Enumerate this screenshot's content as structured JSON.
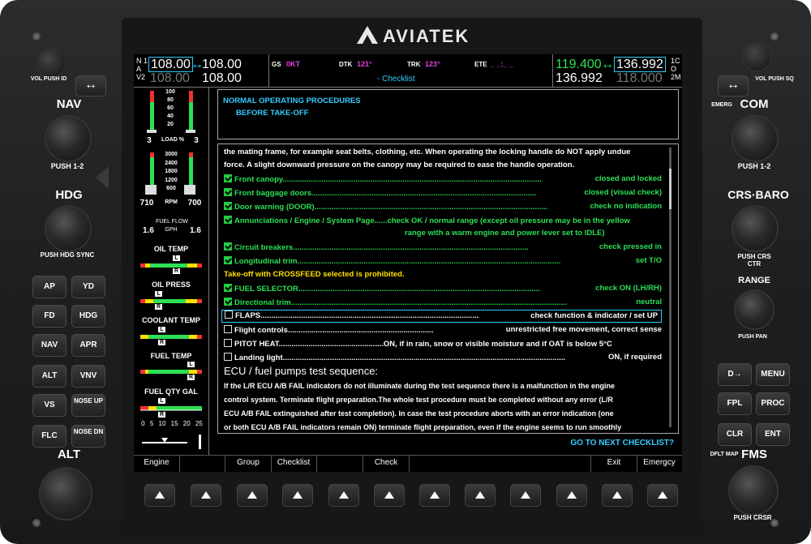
{
  "brand": "AVIATEK",
  "top": {
    "nav_letters": [
      "N",
      "A",
      "V",
      "1",
      "2"
    ],
    "nav_active": "108.00",
    "nav_active_arrow": "↔",
    "nav_standby": "108.00",
    "nav2_active": "108.00",
    "nav2_standby": "108.00",
    "gs_lbl": "GS",
    "gs_val": "0KT",
    "dtk_lbl": "DTK",
    "dtk_val": "121°",
    "trk_lbl": "TRK",
    "trk_val": "123°",
    "ete_lbl": "ETE",
    "ete_val": "_ _:_ _",
    "page_title": "- Checklist",
    "com_active": "119.400",
    "com_arrow": "↔",
    "com_standby": "136.992",
    "com2_active": "136.992",
    "com2_standby": "118.000",
    "com_letters": [
      "1",
      "C",
      "O",
      "2",
      "M"
    ]
  },
  "engine": {
    "load_ticks": [
      "100",
      "80",
      "60",
      "40",
      "20"
    ],
    "load_lbl": "LOAD %",
    "load_l": "3",
    "load_r": "3",
    "rpm_ticks": [
      "3000",
      "2400",
      "1800",
      "1200",
      "600"
    ],
    "rpm_lbl": "RPM",
    "rpm_l": "710",
    "rpm_r": "700",
    "ff_lbl": "FUEL FLOW",
    "ff_unit": "GPH",
    "ff_l": "1.6",
    "ff_r": "1.6",
    "oil_temp": "OIL TEMP",
    "oil_press": "OIL PRESS",
    "coolant": "COOLANT TEMP",
    "fuel_temp": "FUEL TEMP",
    "fuel_qty": "FUEL QTY GAL",
    "lr_l": "L",
    "lr_r": "R",
    "qty_scale": [
      "0",
      "5",
      "10",
      "15",
      "20",
      "25"
    ]
  },
  "procedure": {
    "title": "NORMAL OPERATING PROCEDURES",
    "subtitle": "BEFORE TAKE-OFF"
  },
  "checklist": {
    "intro1": "the mating frame, for example seat belts, clothing, etc. When operating the locking handle do NOT apply undue",
    "intro2": "force. A slight downward pressure on the canopy may be required to ease the handle operation.",
    "items": [
      {
        "l": "Front canopy.........................................................................................................................",
        "r": "closed and locked"
      },
      {
        "l": "Front baggage doors.........................................................................................................",
        "r": "closed (visual check)"
      },
      {
        "l": "Door warning (DOOR).............................................................................................................",
        "r": "check no indication"
      },
      {
        "l": "Annunciations / Engine / System Page......check OK / normal range (except oil pressure may be in the yellow",
        "r": ""
      },
      {
        "l": "Circuit breakers..............................................................................................................",
        "r": "check pressed in"
      },
      {
        "l": "Longitudinal trim...........................................................................................................................",
        "r": "set T/O"
      },
      {
        "l": "FUEL SELECTOR.................................................................................................................",
        "r": "check ON (LH/RH)"
      },
      {
        "l": "Directional trim.................................................................................................................................",
        "r": "neutral"
      },
      {
        "l": "FLAPS......................................................................................................",
        "r": "check function & indicator / set UP"
      },
      {
        "l": "Flight controls....................................................................",
        "r": "unrestricted free movement, correct sense"
      },
      {
        "l": "PITOT HEAT.................................................ON, if in rain, snow or visible moisture and if OAT is below 5°C",
        "r": ""
      },
      {
        "l": "Landing light....................................................................................................................................",
        "r": "ON, if required"
      }
    ],
    "annun_cont": "range with a warm engine and power lever set to IDLE)",
    "caution": "Take-off with CROSSFEED selected is prohibited.",
    "ecu_title": "ECU / fuel pumps test sequence:",
    "ecu_lines": [
      "If the L/R ECU A/B FAIL indicators do not illuminate during the test sequence there is a malfunction in the engine",
      "control system. Terminate flight preparation.The whole test procedure must be completed without any error (L/R",
      "ECU A/B FAIL extinguished after test completion). In case the test procedure aborts with an error indication (one",
      "or both ECU A/B FAIL indicators remain ON) terminate flight preparation, even if the engine seems to run smoothly"
    ],
    "goto": "GO TO NEXT CHECKLIST?"
  },
  "softkeys": [
    "Engine",
    "",
    "Group",
    "Checklist",
    "",
    "Check",
    "",
    "",
    "",
    "Exit",
    "Emergcy"
  ],
  "left_panel": {
    "vol": "VOL",
    "push_id": "PUSH ID",
    "swap": "↔",
    "nav": "NAV",
    "push12": "PUSH 1-2",
    "hdg": "HDG",
    "push_hdg": "PUSH HDG SYNC",
    "keys": [
      [
        "AP",
        "YD"
      ],
      [
        "FD",
        "HDG"
      ],
      [
        "NAV",
        "APR"
      ],
      [
        "ALT",
        "VNV"
      ],
      [
        "VS",
        "NOSE UP"
      ],
      [
        "FLC",
        "NOSE DN"
      ]
    ],
    "alt": "ALT"
  },
  "right_panel": {
    "vol": "VOL",
    "push_sq": "PUSH SQ",
    "swap": "↔",
    "emerg": "EMERG",
    "com": "COM",
    "push12": "PUSH 1-2",
    "crs_baro": "CRS",
    "baro": "BARO",
    "push_crs_ctr": "PUSH CRS CTR",
    "range": "RANGE",
    "push_pan": "PUSH PAN",
    "keys": [
      [
        "D→",
        "MENU"
      ],
      [
        "FPL",
        "PROC"
      ],
      [
        "CLR",
        "ENT"
      ]
    ],
    "dflt_map": "DFLT MAP",
    "fms": "FMS",
    "push_crsr": "PUSH CRSR"
  }
}
